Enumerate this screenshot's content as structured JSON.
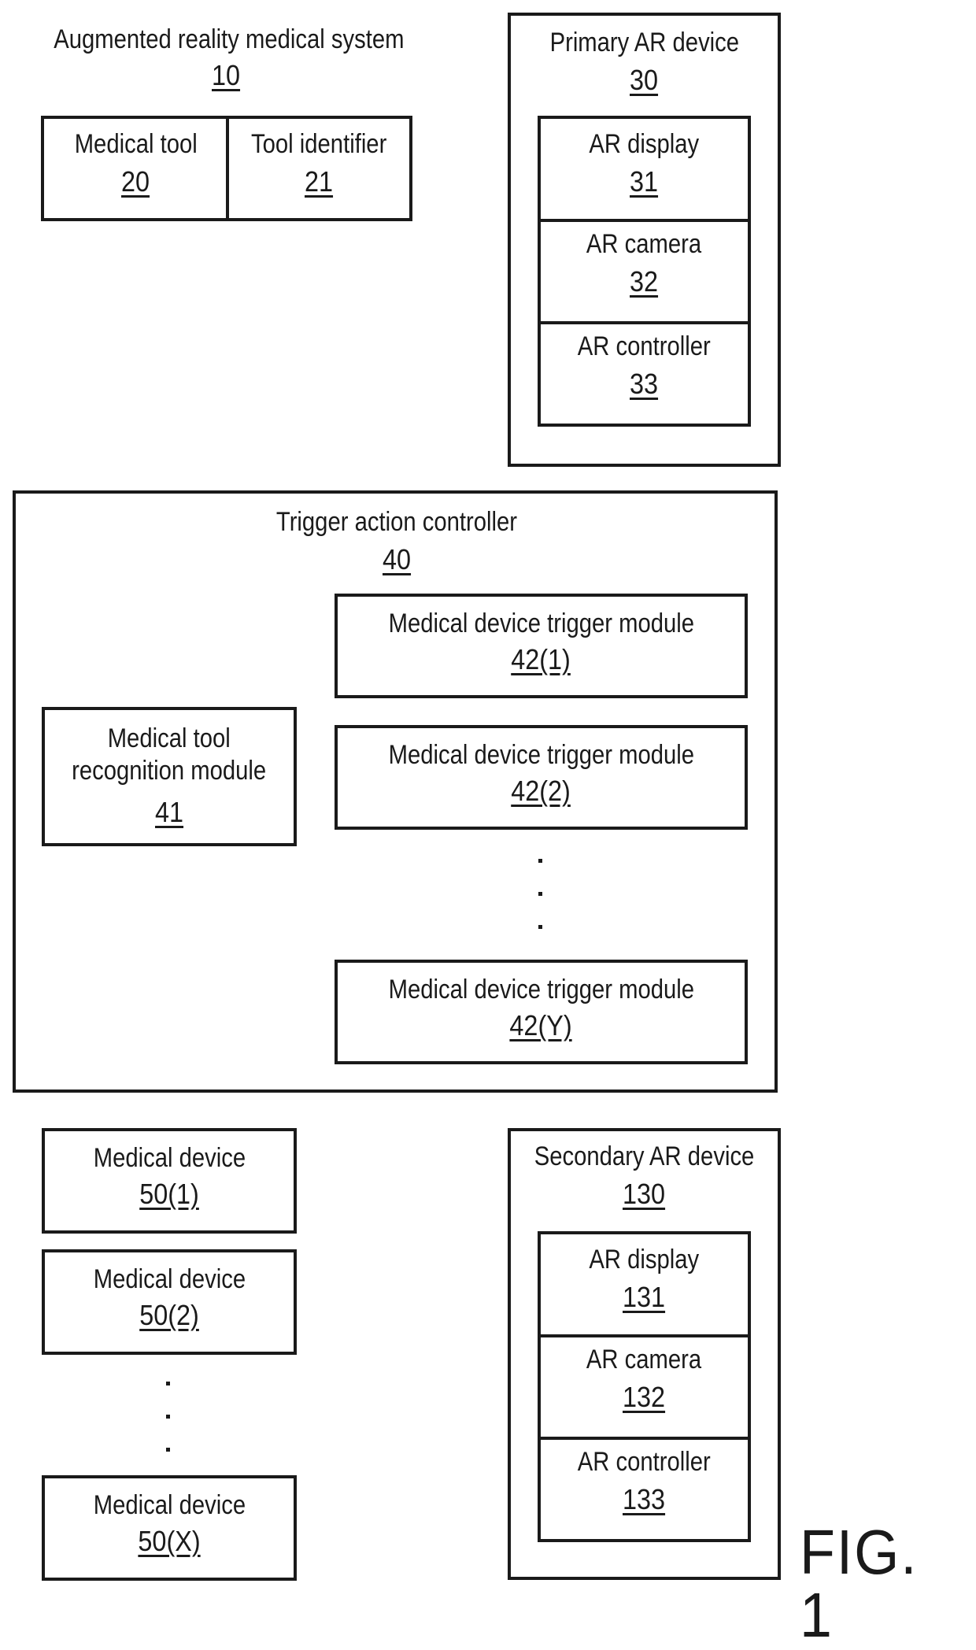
{
  "system": {
    "title": "Augmented reality medical system",
    "ref": "10"
  },
  "tool_box": [
    {
      "label": "Medical tool",
      "ref": "20"
    },
    {
      "label": "Tool identifier",
      "ref": "21"
    }
  ],
  "primary_ar": {
    "title": "Primary AR device",
    "ref": "30",
    "components": [
      {
        "label": "AR display",
        "ref": "31"
      },
      {
        "label": "AR camera",
        "ref": "32"
      },
      {
        "label": "AR controller",
        "ref": "33"
      }
    ]
  },
  "trigger_controller": {
    "title": "Trigger action controller",
    "ref": "40",
    "recognition_module": {
      "label_line1": "Medical tool",
      "label_line2": "recognition module",
      "ref": "41"
    },
    "trigger_modules": [
      {
        "label": "Medical device trigger module",
        "ref": "42(1)"
      },
      {
        "label": "Medical device trigger module",
        "ref": "42(2)"
      },
      {
        "label": "Medical device trigger module",
        "ref": "42(Y)"
      }
    ]
  },
  "medical_devices": [
    {
      "label": "Medical device",
      "ref": "50(1)"
    },
    {
      "label": "Medical device",
      "ref": "50(2)"
    },
    {
      "label": "Medical device",
      "ref": "50(X)"
    }
  ],
  "secondary_ar": {
    "title": "Secondary AR device",
    "ref": "130",
    "components": [
      {
        "label": "AR display",
        "ref": "131"
      },
      {
        "label": "AR camera",
        "ref": "132"
      },
      {
        "label": "AR controller",
        "ref": "133"
      }
    ]
  },
  "figure_label": "FIG. 1"
}
